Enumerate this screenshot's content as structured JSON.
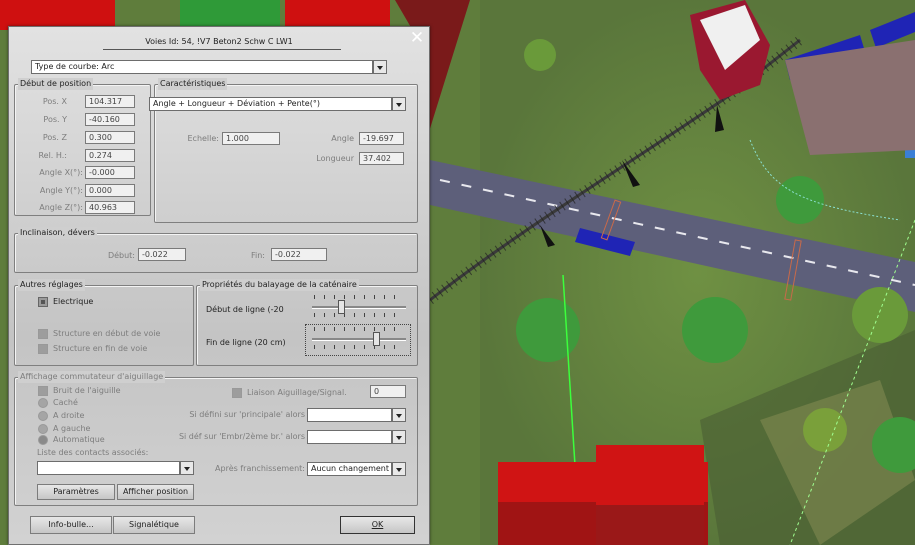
{
  "dialog": {
    "title": "Voies Id: 54, !V7 Beton2 Schw C LW1",
    "curve_type": "Type de courbe: Arc"
  },
  "start_position": {
    "group_title": "Début de position",
    "pos_x_label": "Pos. X",
    "pos_x": "104.317",
    "pos_y_label": "Pos. Y",
    "pos_y": "-40.160",
    "pos_z_label": "Pos. Z",
    "pos_z": "0.300",
    "rel_h_label": "Rel. H.:",
    "rel_h": "0.274",
    "angle_x_label": "Angle X(°):",
    "angle_x": "-0.000",
    "angle_y_label": "Angle Y(°):",
    "angle_y": "0.000",
    "angle_z_label": "Angle Z(°):",
    "angle_z": "40.963"
  },
  "characteristics": {
    "group_title": "Caractéristiques",
    "mode_select": "Angle + Longueur + Déviation + Pente(°)",
    "scale_label": "Echelle:",
    "scale": "1.000",
    "angle_label": "Angle",
    "angle": "-19.697",
    "length_label": "Longueur",
    "length": "37.402"
  },
  "inclination": {
    "group_title": "Inclinaison, dévers",
    "start_label": "Début:",
    "start": "-0.022",
    "end_label": "Fin:",
    "end": "-0.022"
  },
  "other_settings": {
    "group_title": "Autres réglages",
    "electric_label": "Electrique",
    "struct_start_label": "Structure en début de voie",
    "struct_end_label": "Structure en fin de voie"
  },
  "catenary": {
    "group_title": "Propriétés du balayage de la caténaire",
    "line_start_label": "Début de ligne (-20",
    "line_end_label": "Fin de ligne (20 cm)",
    "line_start_level": 0.3,
    "line_end_level": 0.7
  },
  "switch": {
    "group_title": "Affichage commutateur d'aiguillage",
    "noise_label": "Bruit de l'aiguille",
    "hidden_label": "Caché",
    "right_label": "A droite",
    "left_label": "A gauche",
    "auto_label": "Automatique",
    "contacts_label": "Liste des contacts associés:",
    "link_label": "Liaison Aiguillage/Signal.",
    "link_value": "0",
    "if_main_label": "Si défini sur 'principale' alors",
    "if_branch_label": "Si déf sur 'Embr/2ème br.' alors",
    "after_label": "Après franchissement:",
    "after_value": "Aucun changement",
    "params_button": "Paramètres",
    "show_position_button": "Afficher position"
  },
  "footer": {
    "tooltip_button": "Info-bulle...",
    "signaling_button": "Signalétique",
    "ok_button": "OK"
  },
  "colors": {
    "grass": "#5d7a3a",
    "road": "#5d5f7a",
    "building_red": "#cf1010",
    "train_blue": "#1f24b5"
  }
}
